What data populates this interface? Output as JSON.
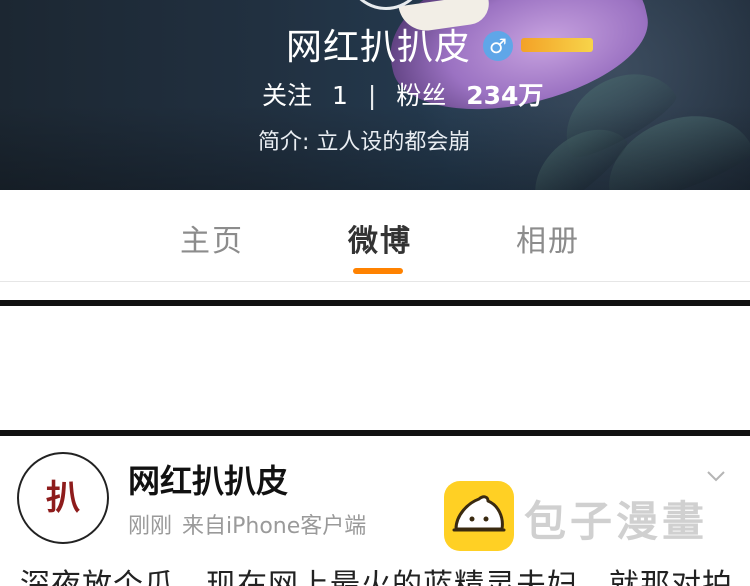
{
  "profile": {
    "name": "网红扒扒皮",
    "gender_icon": "♂",
    "stats": {
      "following_label": "关注",
      "following_count": "1",
      "separator": "|",
      "followers_label": "粉丝",
      "followers_count": "234万"
    },
    "bio": "简介: 立人设的都会崩"
  },
  "tabs": {
    "items": [
      {
        "label": "主页",
        "active": false
      },
      {
        "label": "微博",
        "active": true
      },
      {
        "label": "相册",
        "active": false
      }
    ],
    "accent_color": "#ff8200"
  },
  "post": {
    "avatar_text": "扒",
    "author": "网红扒扒皮",
    "time": "刚刚",
    "source": "来自iPhone客户端",
    "text": "深夜放个瓜，现在网上最火的蓝精灵夫妇，就那对拍"
  },
  "watermark": {
    "text": "包子漫畫",
    "logo_color": "#ffd024"
  }
}
